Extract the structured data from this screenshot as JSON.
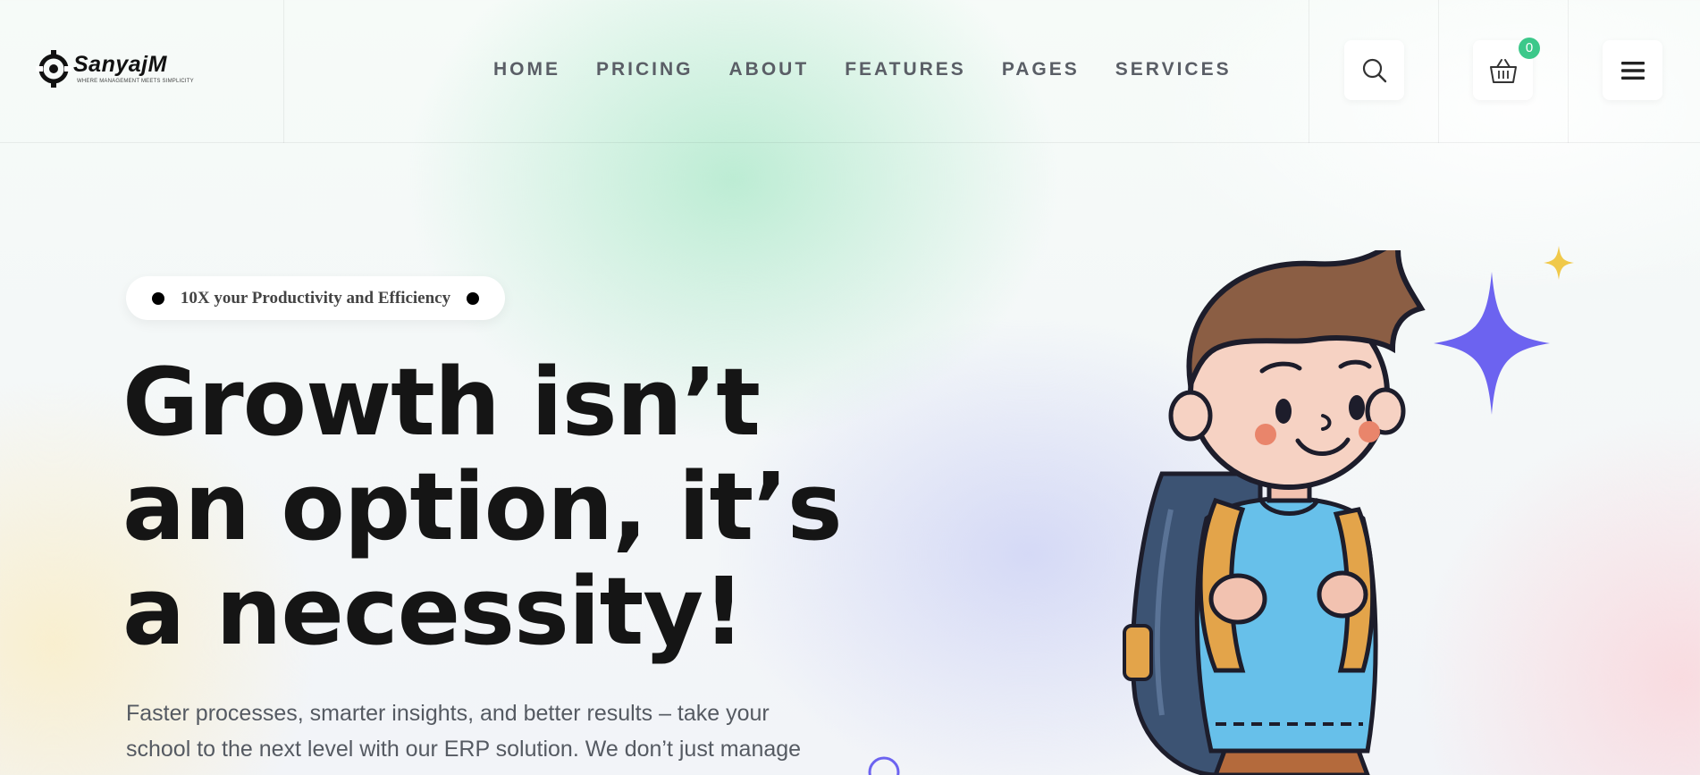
{
  "brand": {
    "name": "SanyajM",
    "tagline": "WHERE MANAGEMENT MEETS SIMPLICITY"
  },
  "nav": {
    "items": [
      "HOME",
      "PRICING",
      "ABOUT",
      "FEATURES",
      "PAGES",
      "SERVICES"
    ]
  },
  "header_actions": {
    "search_icon": "search-icon",
    "cart_icon": "basket-icon",
    "cart_count": "0",
    "menu_icon": "hamburger-icon"
  },
  "hero": {
    "badge_text": "10X your Productivity and Efficiency",
    "title_lines": [
      "Growth isn’t",
      "an option, it’s",
      "a necessity!"
    ],
    "description": "Faster processes, smarter insights, and better results – take your school to the next level with our ERP solution. We don’t just manage"
  },
  "colors": {
    "accent_green": "#3cc88a",
    "star_purple": "#6c63f0",
    "star_yellow": "#f0c94a",
    "title_text": "#151515",
    "nav_text": "#5a5e66"
  }
}
